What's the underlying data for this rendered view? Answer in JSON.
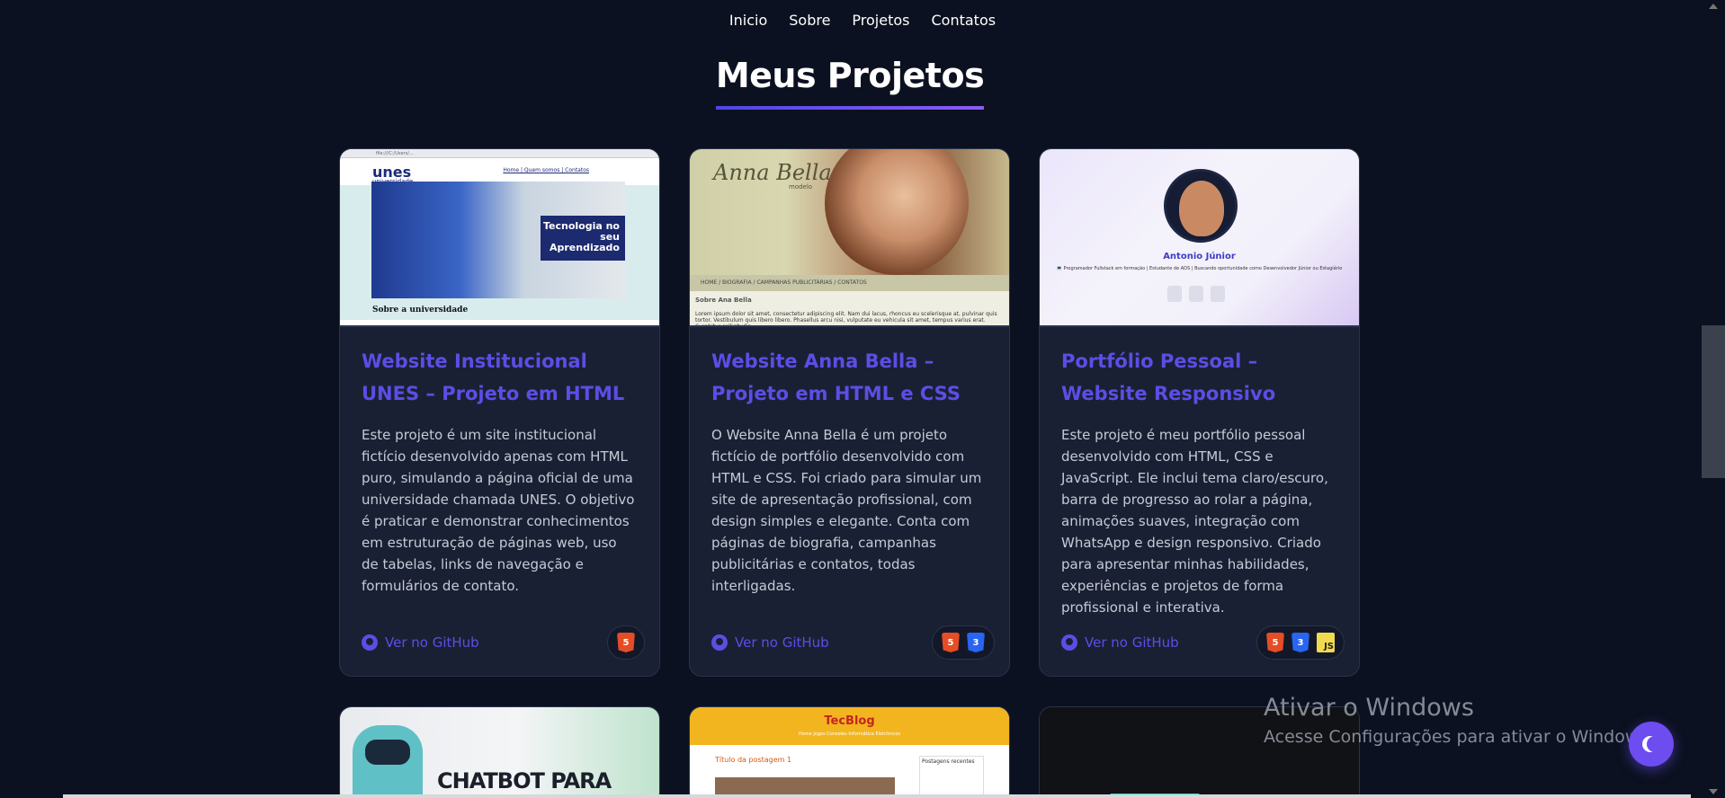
{
  "nav": {
    "items": [
      "Inicio",
      "Sobre",
      "Projetos",
      "Contatos"
    ]
  },
  "section": {
    "title": "Meus Projetos"
  },
  "projects": [
    {
      "title": "Website Institucional UNES – Projeto em HTML",
      "description": "Este projeto é um site institucional fictício desenvolvido apenas com HTML puro, simulando a página oficial de uma universidade chamada UNES. O objetivo é praticar e demonstrar conhecimentos em estruturação de páginas web, uso de tabelas, links de navegação e formulários de contato.",
      "link_label": "Ver no GitHub",
      "tech": [
        "html-icon"
      ],
      "thumb": {
        "logo": "unes",
        "logo_sub": "universidade",
        "links": "Home | Quem somos | Contatos",
        "banner": "Tecnologia no seu Aprendizado",
        "footer": "Sobre a universidade"
      }
    },
    {
      "title": "Website Anna Bella – Projeto em HTML e CSS",
      "description": "O Website Anna Bella é um projeto fictício de portfólio desenvolvido com HTML e CSS. Foi criado para simular um site de apresentação profissional, com design simples e elegante. Conta com páginas de biografia, campanhas publicitárias e contatos, todas interligadas.",
      "link_label": "Ver no GitHub",
      "tech": [
        "html-icon",
        "css-icon"
      ],
      "thumb": {
        "name": "Anna Bella",
        "sub": "modelo",
        "menu": "HOME / BIOGRAFIA / CAMPANHAS PUBLICITÁRIAS / CONTATOS",
        "heading": "Sobre Ana Bella",
        "body": "Lorem ipsum dolor sit amet, consectetur adipiscing elit. Nam dui lacus, rhoncus eu scelerisque at, pulvinar quis tortor. Vestibulum quis libero libero. Phasellus arcu nisi, vulputate eu vehicula sit amet, tempus varius erat. Curabitur sollicitudin"
      }
    },
    {
      "title": "Portfólio Pessoal – Website Responsivo",
      "description": "Este projeto é meu portfólio pessoal desenvolvido com HTML, CSS e JavaScript. Ele inclui tema claro/escuro, barra de progresso ao rolar a página, animações suaves, integração com WhatsApp e design responsivo. Criado para apresentar minhas habilidades, experiências e projetos de forma profissional e interativa.",
      "link_label": "Ver no GitHub",
      "tech": [
        "html-icon",
        "css-icon",
        "js-icon"
      ],
      "thumb": {
        "name": "Antonio Júnior",
        "desc": "💻 Programador Fullstack em formação | Estudante de ADS | Buscando oportunidade como Desenvolvedor Júnior ou Estagiário"
      }
    }
  ],
  "projects_row2": [
    {
      "thumb_text": "CHATBOT PARA"
    },
    {
      "thumb_brand_a": "Tec",
      "thumb_brand_b": "Blog",
      "thumb_menu": "Home   Jogos   Consoles   Informática   Eletrônicos",
      "thumb_post": "Título da postagem 1",
      "thumb_side": "Postagens recentes"
    },
    {}
  ],
  "tech_labels": {
    "js": "JS"
  },
  "watermark": {
    "line1": "Ativar o Windows",
    "line2": "Acesse Configurações para ativar o Windows."
  },
  "colors": {
    "background": "#0b1120",
    "card": "#1a2033",
    "accent": "#5b4ee6",
    "theme_button": "#6d4cf0"
  }
}
